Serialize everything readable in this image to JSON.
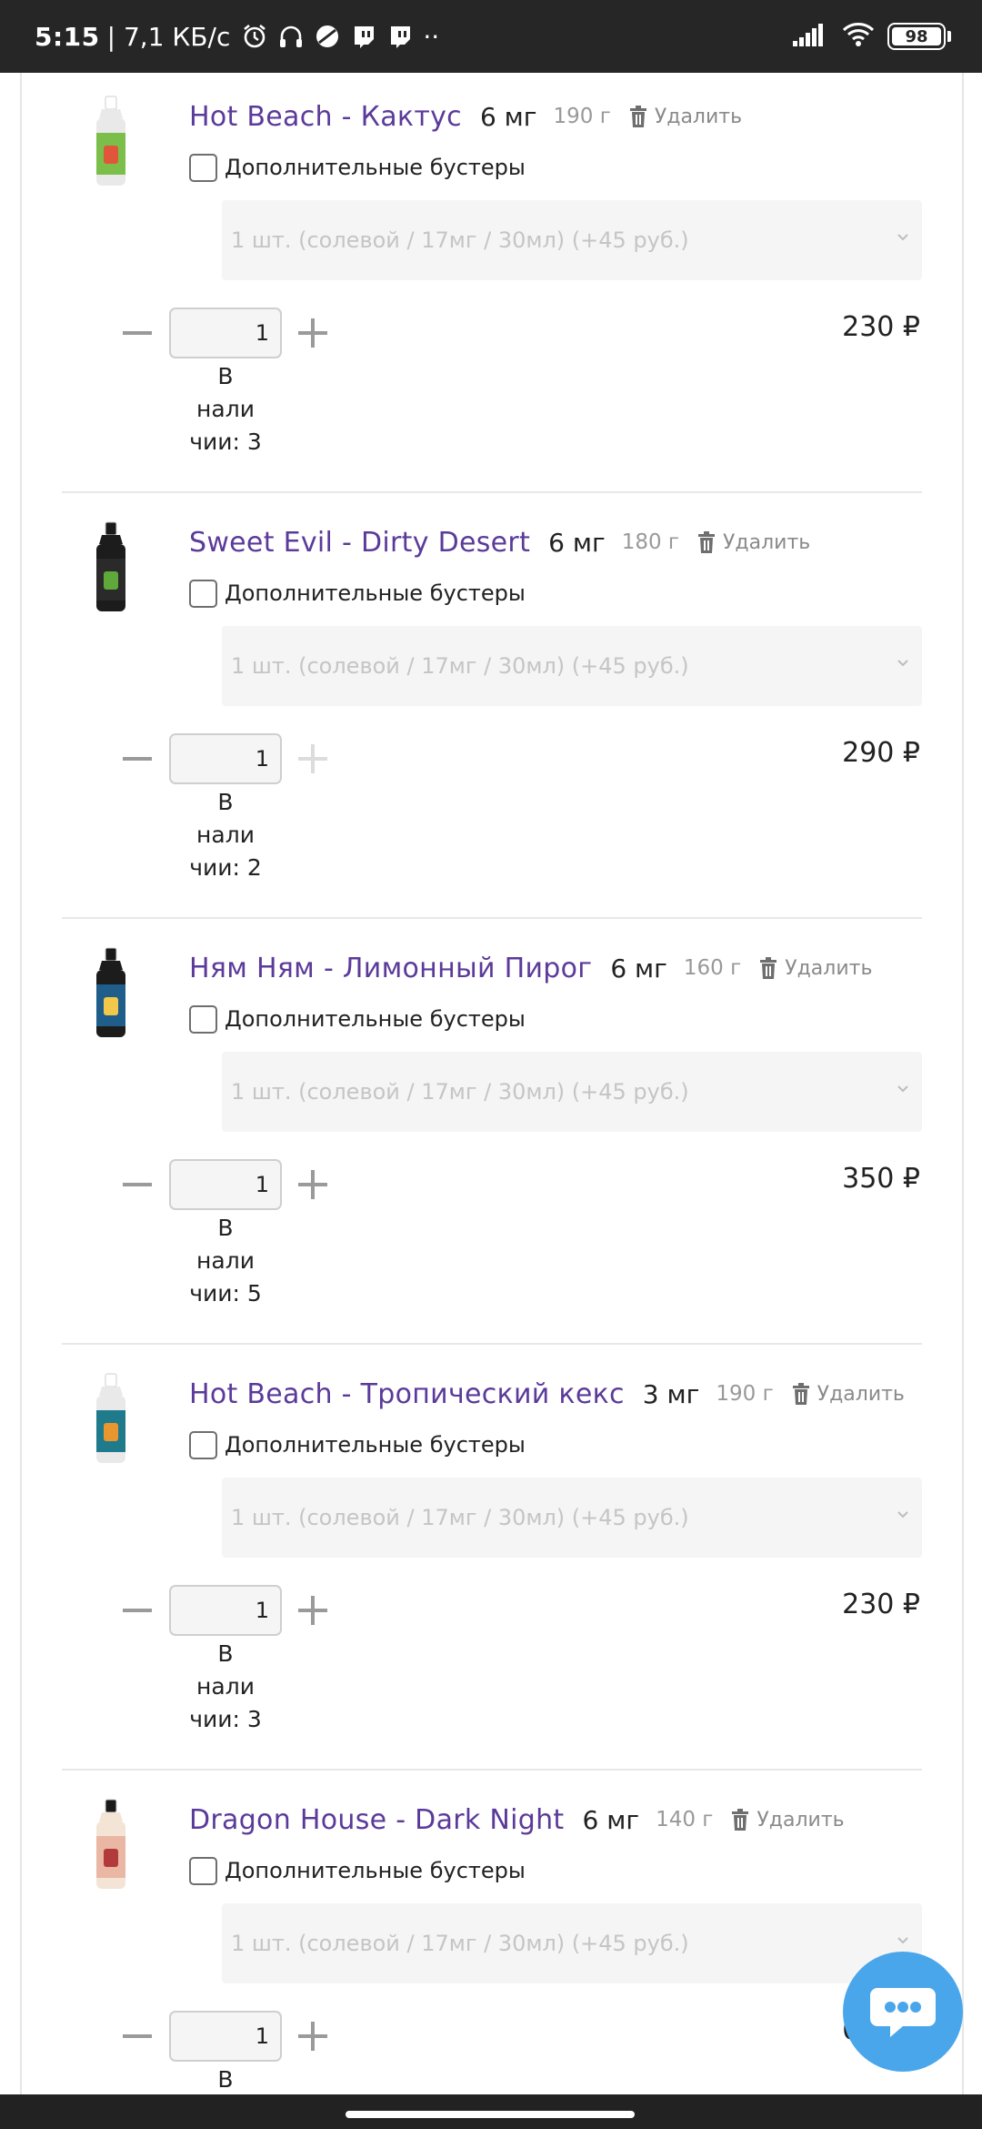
{
  "status_bar": {
    "time": "5:15",
    "network_speed": "| 7,1 КБ/с",
    "more": "··",
    "battery": "98"
  },
  "cart": {
    "delete_label": "Удалить",
    "boosters_label": "Дополнительные бустеры",
    "booster_option": "1 шт. (солевой / 17мг / 30мл) (+45 руб.)",
    "stock_line1": "В",
    "stock_line2": "нали",
    "items": [
      {
        "name": "Hot Beach - Кактус",
        "nicotine": "6 мг",
        "weight": "190 г",
        "quantity": "1",
        "stock_line3": "чии: 3",
        "price": "230 ₽",
        "bottle_cap": "#ffffff",
        "bottle_body": "#e9e9e9",
        "label_color": "#7bbf4a",
        "label_accent": "#e0563a"
      },
      {
        "name": "Sweet Evil - Dirty Desert",
        "nicotine": "6 мг",
        "weight": "180 г",
        "quantity": "1",
        "stock_line3": "чии: 2",
        "price": "290 ₽",
        "bottle_cap": "#1a1a1a",
        "bottle_body": "#1c1c1c",
        "label_color": "#2a2a2a",
        "label_accent": "#5fa83a"
      },
      {
        "name": "Ням Ням - Лимонный Пирог",
        "nicotine": "6 мг",
        "weight": "160 г",
        "quantity": "1",
        "stock_line3": "чии: 5",
        "price": "350 ₽",
        "bottle_cap": "#1a1a1a",
        "bottle_body": "#1c1c1c",
        "label_color": "#1f5d8a",
        "label_accent": "#f2c84b"
      },
      {
        "name": "Hot Beach - Тропический кекс",
        "nicotine": "3 мг",
        "weight": "190 г",
        "quantity": "1",
        "stock_line3": "чии: 3",
        "price": "230 ₽",
        "bottle_cap": "#ffffff",
        "bottle_body": "#e9e9e9",
        "label_color": "#1f7a8c",
        "label_accent": "#e9962f"
      },
      {
        "name": "Dragon House - Dark Night",
        "nicotine": "6 мг",
        "weight": "140 г",
        "quantity": "1",
        "stock_line3": "",
        "price": "630 ₽",
        "bottle_cap": "#1a1a1a",
        "bottle_body": "#f3e4d6",
        "label_color": "#e9b7a4",
        "label_accent": "#b33a3a"
      }
    ]
  }
}
